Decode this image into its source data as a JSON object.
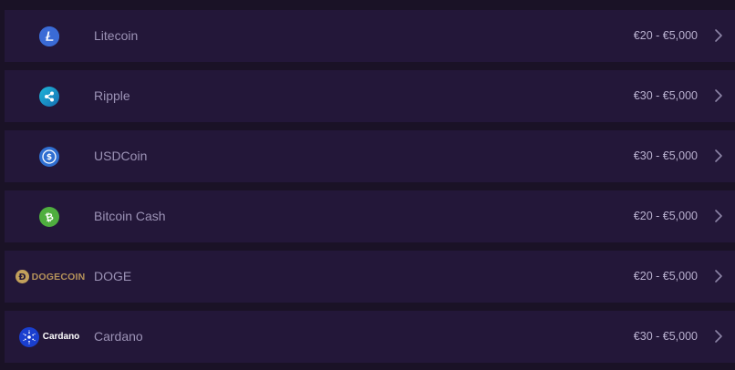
{
  "colors": {
    "page_background": "#1a1226",
    "row_background": "#231739",
    "name_text": "#9c93b6",
    "range_text": "#b9b1cf",
    "litecoin": "#3a6bd6",
    "ripple": "#1a9ecf",
    "usdcoin": "#2f6fd1",
    "bitcoin_cash": "#4fae3f",
    "doge": "#c2a05b",
    "cardano": "#1a3fcf"
  },
  "currencies": [
    {
      "name": "Litecoin",
      "range": "€20 - €5,000",
      "icon": "litecoin-icon"
    },
    {
      "name": "Ripple",
      "range": "€30 - €5,000",
      "icon": "ripple-icon"
    },
    {
      "name": "USDCoin",
      "range": "€30 - €5,000",
      "icon": "usdcoin-icon"
    },
    {
      "name": "Bitcoin Cash",
      "range": "€20 - €5,000",
      "icon": "bitcoin-cash-icon"
    },
    {
      "name": "DOGE",
      "range": "€20 - €5,000",
      "icon": "dogecoin-logo",
      "logo_text": "DOGECOIN"
    },
    {
      "name": "Cardano",
      "range": "€30 - €5,000",
      "icon": "cardano-logo",
      "logo_text": "Cardano"
    }
  ]
}
